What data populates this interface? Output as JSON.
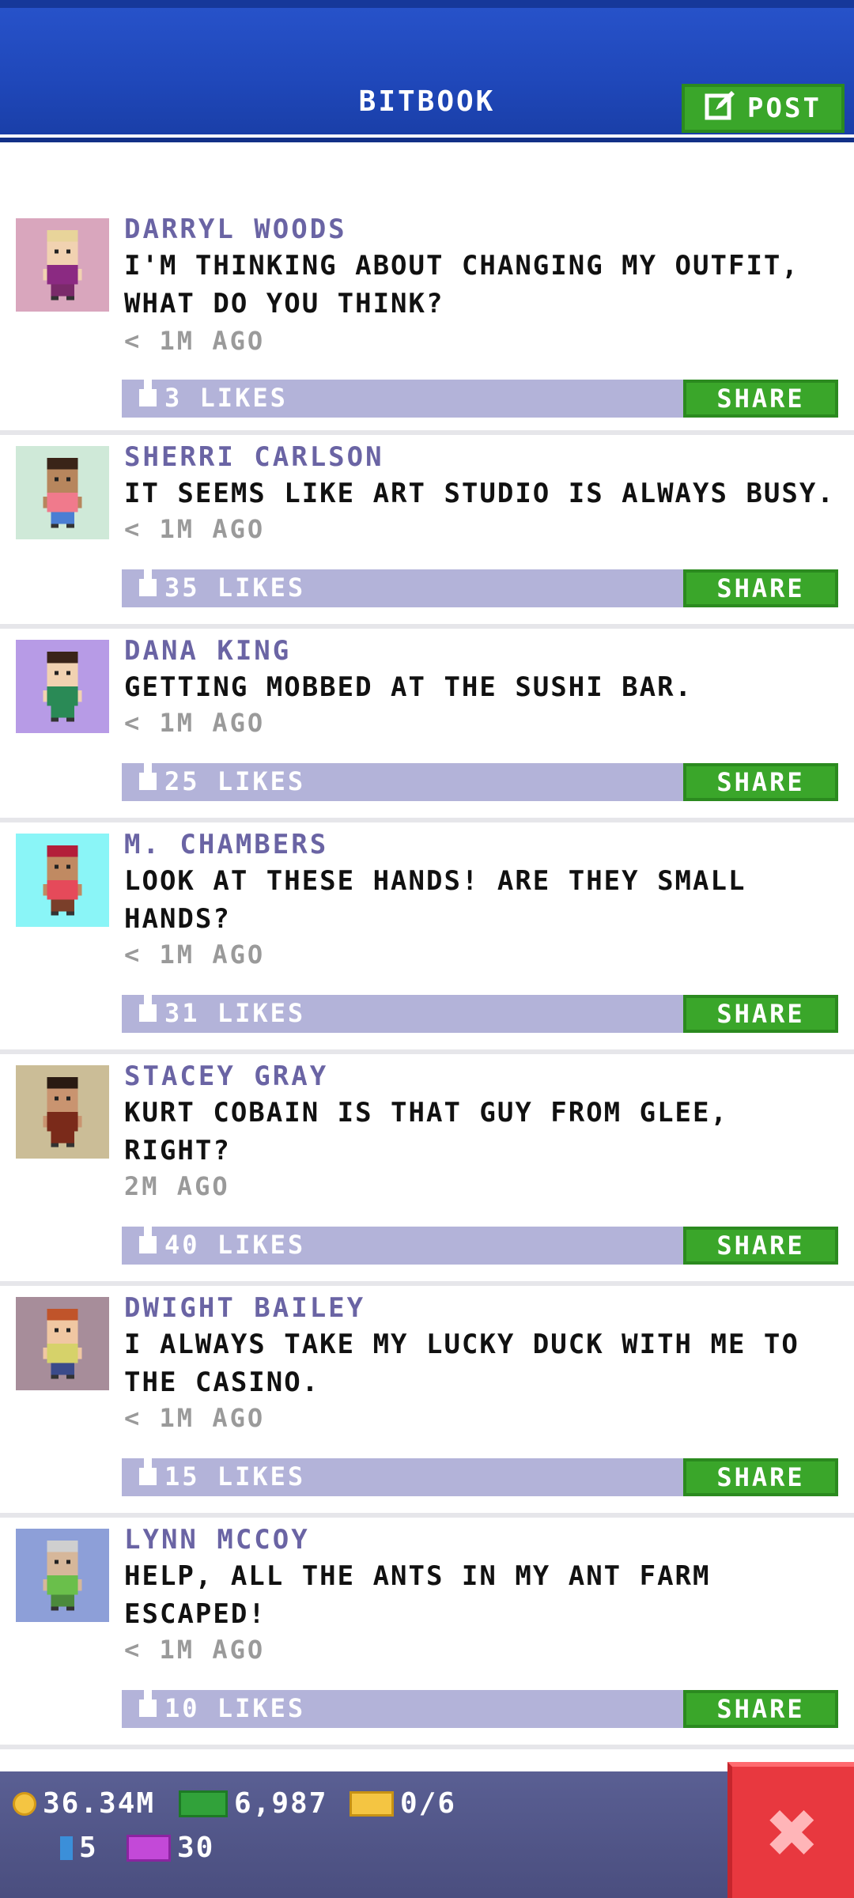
{
  "header": {
    "title": "BITBOOK",
    "post_label": "POST"
  },
  "posts": [
    {
      "name": "DARRYL WOODS",
      "text": "I'M THINKING ABOUT CHANGING MY OUTFIT, WHAT DO YOU THINK?",
      "time": "< 1M AGO",
      "likes": "3 LIKES",
      "share": "SHARE",
      "avatar_bg": "#d9a6bd",
      "skin": "#f1d2b1",
      "hair": "#e8d49a",
      "shirt": "#8b2a82",
      "pants": "#7a2a6a"
    },
    {
      "name": "SHERRI CARLSON",
      "text": "IT SEEMS LIKE ART STUDIO IS ALWAYS BUSY.",
      "time": "< 1M AGO",
      "likes": "35 LIKES",
      "share": "SHARE",
      "avatar_bg": "#cfe9d8",
      "skin": "#b7865d",
      "hair": "#3a2418",
      "shirt": "#f07a8c",
      "pants": "#4a7ed3"
    },
    {
      "name": "DANA KING",
      "text": "GETTING MOBBED AT THE SUSHI BAR.",
      "time": "< 1M AGO",
      "likes": "25 LIKES",
      "share": "SHARE",
      "avatar_bg": "#b79be6",
      "skin": "#f1d2b1",
      "hair": "#3a2418",
      "shirt": "#2a8a56",
      "pants": "#2a8a56"
    },
    {
      "name": "M. CHAMBERS",
      "text": "LOOK AT THESE HANDS! ARE THEY SMALL HANDS?",
      "time": "< 1M AGO",
      "likes": "31 LIKES",
      "share": "SHARE",
      "avatar_bg": "#8af5f7",
      "skin": "#c08a62",
      "hair": "#b31e3a",
      "shirt": "#e54a5a",
      "pants": "#7a3f2a"
    },
    {
      "name": "STACEY GRAY",
      "text": "KURT COBAIN IS THAT GUY FROM GLEE, RIGHT?",
      "time": "2M AGO",
      "likes": "40 LIKES",
      "share": "SHARE",
      "avatar_bg": "#cbbd97",
      "skin": "#c99470",
      "hair": "#2a1a12",
      "shirt": "#7a2a1a",
      "pants": "#7a2a1a"
    },
    {
      "name": "DWIGHT BAILEY",
      "text": "I ALWAYS TAKE MY LUCKY DUCK WITH ME TO THE CASINO.",
      "time": "< 1M AGO",
      "likes": "15 LIKES",
      "share": "SHARE",
      "avatar_bg": "#a78d9a",
      "skin": "#f0c7a2",
      "hair": "#c0542a",
      "shirt": "#d6d26a",
      "pants": "#3b4b8a"
    },
    {
      "name": "LYNN MCCOY",
      "text": "HELP, ALL THE ANTS IN MY ANT FARM ESCAPED!",
      "time": "< 1M AGO",
      "likes": "10 LIKES",
      "share": "SHARE",
      "avatar_bg": "#8d9fd8",
      "skin": "#d6b79a",
      "hair": "#cfcfcf",
      "shirt": "#6abf4b",
      "pants": "#4b8a3b"
    }
  ],
  "footer": {
    "coins": "36.34M",
    "cash": "6,987",
    "tickets": "0/6",
    "bux": "5",
    "tv": "30"
  },
  "colors": {
    "header": "#2752c9",
    "share_green": "#3aa62a",
    "like_bar": "#b3b3d9",
    "name_purple": "#6a64a4",
    "close_red": "#e8383f"
  }
}
